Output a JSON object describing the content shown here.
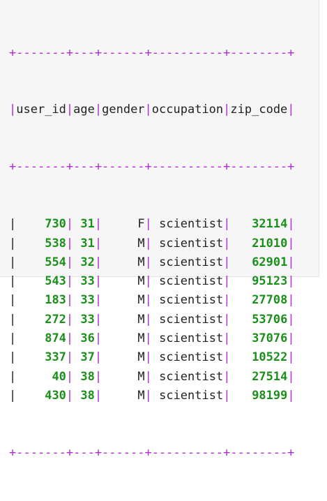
{
  "colors": {
    "border": "#b22ad6",
    "number": "#1a8f1a",
    "text": "#222222",
    "background": "#f6f6f6"
  },
  "table": {
    "separator": "+-------+---+------+----------+--------+",
    "columns": [
      {
        "label": "user_id",
        "width": 7,
        "align": "right",
        "numeric": true
      },
      {
        "label": "age",
        "width": 3,
        "align": "right",
        "numeric": true
      },
      {
        "label": "gender",
        "width": 6,
        "align": "right",
        "numeric": false
      },
      {
        "label": "occupation",
        "width": 10,
        "align": "right",
        "numeric": false
      },
      {
        "label": "zip_code",
        "width": 8,
        "align": "right",
        "numeric": true
      }
    ],
    "rows": [
      [
        "730",
        "31",
        "F",
        "scientist",
        "32114"
      ],
      [
        "538",
        "31",
        "M",
        "scientist",
        "21010"
      ],
      [
        "554",
        "32",
        "M",
        "scientist",
        "62901"
      ],
      [
        "543",
        "33",
        "M",
        "scientist",
        "95123"
      ],
      [
        "183",
        "33",
        "M",
        "scientist",
        "27708"
      ],
      [
        "272",
        "33",
        "M",
        "scientist",
        "53706"
      ],
      [
        "874",
        "36",
        "M",
        "scientist",
        "37076"
      ],
      [
        "337",
        "37",
        "M",
        "scientist",
        "10522"
      ],
      [
        "40",
        "38",
        "M",
        "scientist",
        "27514"
      ],
      [
        "430",
        "38",
        "M",
        "scientist",
        "98199"
      ]
    ]
  }
}
